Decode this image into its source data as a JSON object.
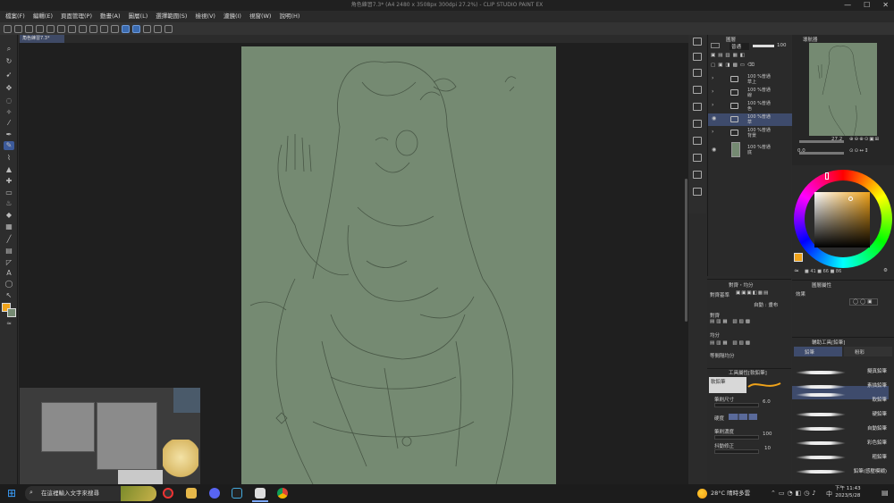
{
  "window": {
    "title": "角色練習7.3* (A4 2480 x 3508px 300dpi 27.2%) - CLIP STUDIO PAINT EX",
    "minimize": "—",
    "maximize": "☐",
    "close": "✕"
  },
  "menu": [
    "檔案(F)",
    "編輯(E)",
    "頁面管理(P)",
    "動畫(A)",
    "圖層(L)",
    "選擇範圍(S)",
    "檢視(V)",
    "濾鏡(I)",
    "視窗(W)",
    "說明(H)"
  ],
  "document_tab": "角色練習7.3*",
  "layers": {
    "blend_mode": "普通",
    "opacity": "100",
    "items": [
      {
        "percent": "100 %普通",
        "name": "草上",
        "selected": false
      },
      {
        "percent": "100 %普通",
        "name": "線",
        "selected": false
      },
      {
        "percent": "100 %普通",
        "name": "色",
        "selected": false
      },
      {
        "percent": "100 %普通",
        "name": "草",
        "selected": true
      },
      {
        "percent": "100 %普通",
        "name": "背景",
        "selected": false
      },
      {
        "percent": "100 %普通",
        "name": "底",
        "selected": false
      }
    ]
  },
  "navigator": {
    "zoom": "27.2",
    "angle": "0.0"
  },
  "color": {
    "main": "#f0a31a",
    "hue": "41",
    "saturation": "66",
    "value": "86"
  },
  "align_panel": {
    "tab": "對齊・均分",
    "reference_label": "對齊基準",
    "auto_label": "自動 : 畫布",
    "align_label": "對齊",
    "distribute_label": "均分",
    "equal_label": "等間隔均分"
  },
  "tool_property": {
    "tab": "工具屬性[軟鉛筆]",
    "brush_name": "軟鉛筆",
    "brush_size_label": "筆刷尺寸",
    "brush_size": "6.0",
    "hardness_label": "硬度",
    "density_label": "筆刷濃度",
    "density": "100",
    "stabilization_label": "抖動修正",
    "stabilization": "10"
  },
  "layer_property": {
    "tab": "圖層屬性",
    "effect_label": "效果"
  },
  "subtool": {
    "tab": "輔助工具[鉛筆]",
    "tabs": [
      "鉛筆",
      "粉彩"
    ],
    "brushes": [
      "擬真鉛筆",
      "素描鉛筆",
      "軟鉛筆",
      "硬鉛筆",
      "自動鉛筆",
      "彩色鉛筆",
      "粗鉛筆",
      "鉛筆(感壓模糊)"
    ]
  },
  "taskbar": {
    "search_placeholder": "在這裡輸入文字來搜尋",
    "weather": "28°C 晴時多雲",
    "ime": "中",
    "time": "下午 11:43",
    "date": "2023/5/28"
  }
}
